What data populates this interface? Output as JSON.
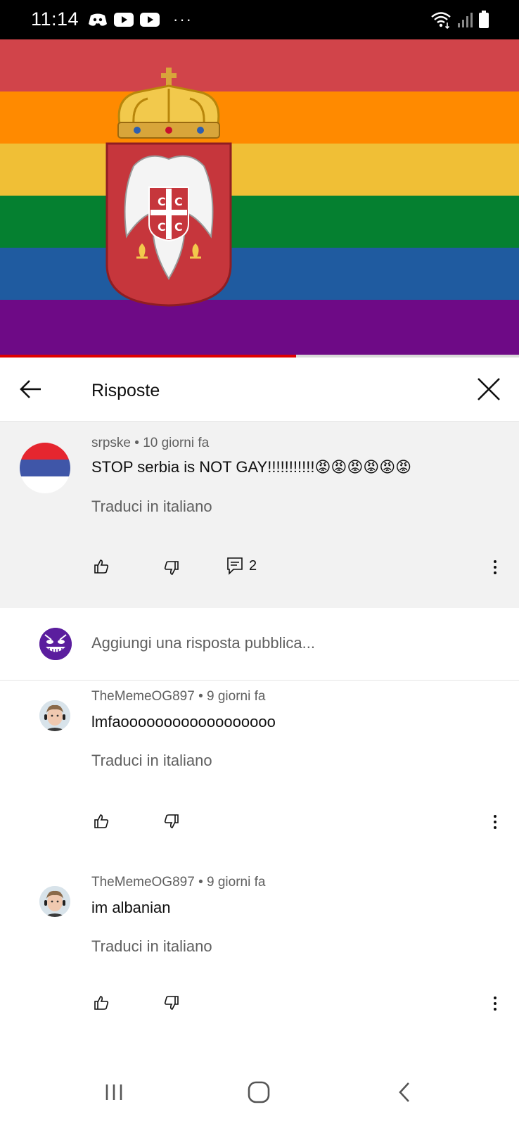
{
  "status_bar": {
    "time": "11:14",
    "left_icons": [
      "discord-icon",
      "youtube-icon",
      "youtube-icon",
      "more-dots-icon"
    ],
    "right_icons": [
      "wifi-icon",
      "signal-icon",
      "battery-icon"
    ]
  },
  "video": {
    "flag_colors": [
      "#d1444a",
      "#ff8a00",
      "#f0bf36",
      "#058030",
      "#1f5ba0",
      "#6e0a86"
    ],
    "progress": 0.57
  },
  "header": {
    "back_icon": "arrow-back-icon",
    "title": "Risposte",
    "close_icon": "close-icon"
  },
  "parent_comment": {
    "author": "srpske",
    "time": "10 giorni fa",
    "separator": " • ",
    "text": "STOP serbia is NOT GAY!!!!!!!!!!!😡😡😡😡😡😡",
    "translate": "Traduci in italiano",
    "reply_count": "2"
  },
  "add_reply": {
    "placeholder": "Aggiungi una risposta pubblica..."
  },
  "replies": [
    {
      "author": "TheMemeOG897",
      "time": "9 giorni fa",
      "text": "lmfaoooooooooooooooooo",
      "translate": "Traduci in italiano"
    },
    {
      "author": "TheMemeOG897",
      "time": "9 giorni fa",
      "text": "im albanian",
      "translate": "Traduci in italiano"
    }
  ],
  "nav_bar": {
    "icons": [
      "recent-apps-icon",
      "home-icon",
      "nav-back-icon"
    ]
  }
}
